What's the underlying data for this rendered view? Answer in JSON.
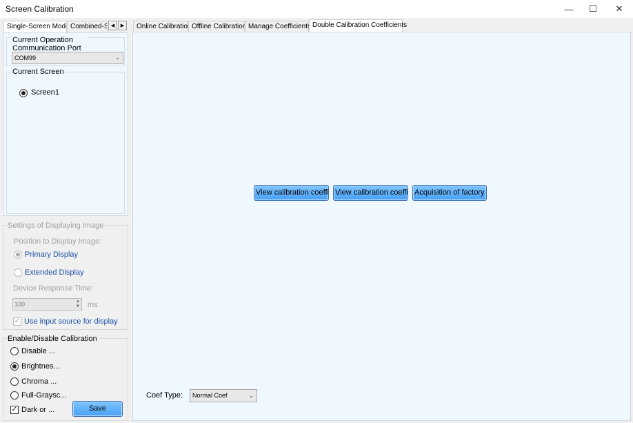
{
  "window": {
    "title": "Screen Calibration",
    "minimize_glyph": "—",
    "maximize_glyph": "☐",
    "close_glyph": "✕"
  },
  "left_tabs": {
    "single": "Single-Screen Mode",
    "combined": "Combined-Sc",
    "prev_glyph": "◀",
    "next_glyph": "▶"
  },
  "port_group": {
    "label": "Current Operation Communication Port",
    "selected": "COM99"
  },
  "screen_group": {
    "label": "Current Screen",
    "option": "Screen1"
  },
  "display_settings": {
    "label": "Settings of Displaying Image",
    "position_label": "Position to Display Image:",
    "primary": "Primary Display",
    "extended": "Extended Display",
    "response_label": "Device Response Time:",
    "response_value": "100",
    "response_unit": "ms",
    "input_source": "Use input source for display"
  },
  "calibration": {
    "label": "Enable/Disable Calibration",
    "disable": "Disable ...",
    "brightness": "Brightnes...",
    "chroma": "Chroma ...",
    "full_gray": "Full-Graysc...",
    "dark": "Dark or ...",
    "save": "Save"
  },
  "right_tabs": {
    "online": "Online Calibration",
    "offline": "Offline Calibration",
    "manage": "Manage Coefficients",
    "double": "Double Calibration Coefficients"
  },
  "main": {
    "btn1": "View calibration coeffi...",
    "btn2": "View calibration coeffi...",
    "btn3": "Acquisition of factory ...",
    "coef_label": "Coef Type:",
    "coef_value": "Normal Coef"
  }
}
